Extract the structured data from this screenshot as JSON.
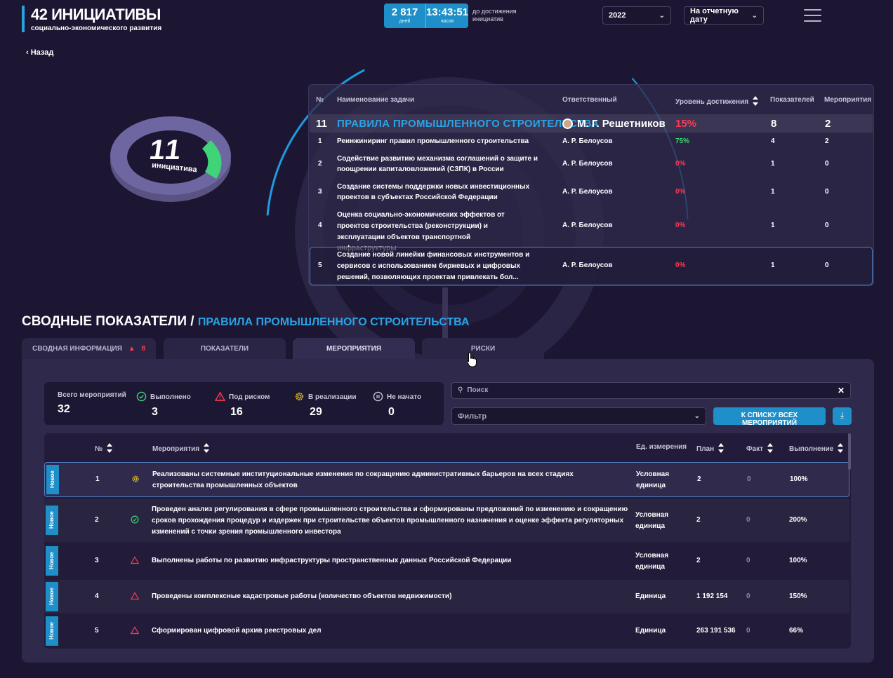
{
  "header": {
    "title": "42 ИНИЦИАТИВЫ",
    "subtitle": "социально-экономического развития",
    "timer": {
      "days": "2 817",
      "days_label": "дней",
      "time": "13:43:51",
      "time_label": "часов",
      "caption": "до достижения инициатив"
    },
    "year": "2022",
    "date_mode": "На отчетную дату",
    "back_label": "Назад"
  },
  "ring": {
    "count": "11",
    "label": "инициатива"
  },
  "top_table": {
    "headers": [
      "№",
      "Наименование задачи",
      "Ответственный",
      "Уровень достижения",
      "Показателей",
      "Мероприятия"
    ],
    "main": {
      "num": "11",
      "name": "ПРАВИЛА ПРОМЫШЛЕННОГО СТРОИТЕЛЬСТВА",
      "owner": "М. Г. Решетников",
      "level": "15%",
      "indicators": "8",
      "events": "2"
    },
    "rows": [
      {
        "num": "1",
        "name": "Реинжиниринг правил промышленного строительства",
        "owner": "А. Р. Белоусов",
        "level": "75%",
        "indicators": "4",
        "events": "2"
      },
      {
        "num": "2",
        "name": "Содействие развитию механизма соглашений о защите и поощрении капиталовложений (СЗПК) в России",
        "owner": "А. Р. Белоусов",
        "level": "0%",
        "indicators": "1",
        "events": "0"
      },
      {
        "num": "3",
        "name": "Создание системы поддержки новых инвестиционных проектов в субъектах Российской Федерации",
        "owner": "А. Р. Белоусов",
        "level": "0%",
        "indicators": "1",
        "events": "0"
      },
      {
        "num": "4",
        "name": "Оценка социально-экономических эффектов от проектов строительства (реконструкции) и эксплуатации объектов транспортной инфраструктуры",
        "owner": "А. Р. Белоусов",
        "level": "0%",
        "indicators": "1",
        "events": "0"
      },
      {
        "num": "5",
        "name": "Создание новой линейки финансовых инструментов и сервисов с использованием биржевых и цифровых решений, позволяющих проектам привлекать бол...",
        "owner": "А. Р. Белоусов",
        "level": "0%",
        "indicators": "1",
        "events": "0"
      }
    ]
  },
  "section": {
    "title": "СВОДНЫЕ ПОКАЗАТЕЛИ",
    "separator": "/",
    "subtitle": "ПРАВИЛА ПРОМЫШЛЕННОГО СТРОИТЕЛЬСТВА"
  },
  "tabs": [
    {
      "label": "СВОДНАЯ ИНФОРМАЦИЯ",
      "badge": "8"
    },
    {
      "label": "ПОКАЗАТЕЛИ"
    },
    {
      "label": "МЕРОПРИЯТИЯ"
    },
    {
      "label": "РИСКИ"
    }
  ],
  "stats": {
    "total_label": "Всего мероприятий",
    "total": "32",
    "done_label": "Выполнено",
    "done": "3",
    "risk_label": "Под риском",
    "risk": "16",
    "progress_label": "В реализации",
    "progress": "29",
    "notstarted_label": "Не начато",
    "notstarted": "0"
  },
  "search": {
    "placeholder": "Поиск"
  },
  "filter": {
    "placeholder": "Фильтр"
  },
  "buttons": {
    "all_events": "К СПИСКУ ВСЕХ МЕРОПРИЯТИЙ"
  },
  "events_table": {
    "headers": [
      "№",
      "Мероприятия",
      "Ед. измерения",
      "План",
      "Факт",
      "Выполнение"
    ],
    "tag": "Новое",
    "rows": [
      {
        "num": "1",
        "name": "Реализованы системные институциональные изменения по сокращению административных барьеров на всех стадиях строительства промышленных объектов",
        "unit": "Условная единица",
        "plan": "2",
        "fact": "0",
        "done": "100%"
      },
      {
        "num": "2",
        "name": "Проведен анализ регулирования в сфере промышленного строительства и сформированы предложений по изменению и сокращению сроков прохождения процедур и издержек при строительстве объектов промышленного назначения и оценке эффекта регуляторных изменений с точки зрения промышленного инвестора",
        "unit": "Условная единица",
        "plan": "2",
        "fact": "0",
        "done": "200%"
      },
      {
        "num": "3",
        "name": "Выполнены работы по развитию инфраструктуры пространственных данных Российской Федерации",
        "unit": "Условная единица",
        "plan": "2",
        "fact": "0",
        "done": "100%"
      },
      {
        "num": "4",
        "name": "Проведены комплексные кадастровые работы (количество объектов недвижимости)",
        "unit": "Единица",
        "plan": "1 192 154",
        "fact": "0",
        "done": "150%"
      },
      {
        "num": "5",
        "name": "Сформирован цифровой архив реестровых дел",
        "unit": "Единица",
        "plan": "263 191 536",
        "fact": "0",
        "done": "66%"
      }
    ]
  },
  "colors": {
    "accent": "#1e8fc8",
    "risk": "#ff3a54",
    "done": "#3fd477",
    "progress": "#e0c020"
  }
}
